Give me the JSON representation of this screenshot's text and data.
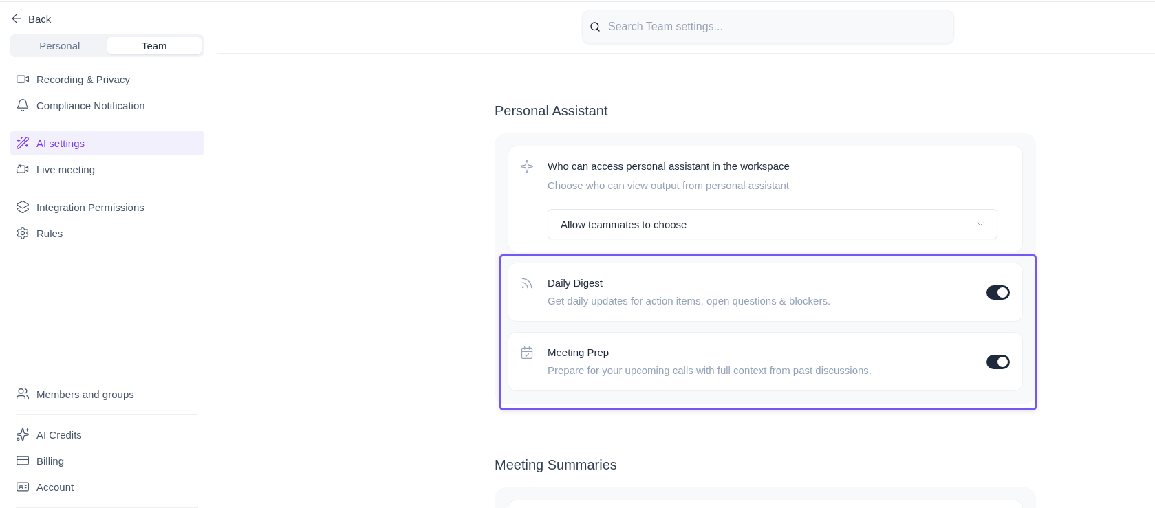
{
  "sidebar": {
    "back": "Back",
    "scope_tabs": [
      {
        "label": "Personal",
        "selected": false
      },
      {
        "label": "Team",
        "selected": true
      }
    ],
    "top_sections": [
      {
        "items": [
          {
            "label": "Recording & Privacy",
            "selected": false
          },
          {
            "label": "Compliance Notification",
            "selected": false
          }
        ]
      },
      {
        "items": [
          {
            "label": "AI settings",
            "selected": true
          },
          {
            "label": "Live meeting",
            "selected": false
          }
        ]
      },
      {
        "items": [
          {
            "label": "Integration Permissions",
            "selected": false
          },
          {
            "label": "Rules",
            "selected": false
          }
        ]
      }
    ],
    "bottom_sections": [
      {
        "items": [
          {
            "label": "Members and groups",
            "selected": false
          }
        ]
      },
      {
        "items": [
          {
            "label": "AI Credits",
            "selected": false
          },
          {
            "label": "Billing",
            "selected": false
          },
          {
            "label": "Account",
            "selected": false
          }
        ]
      }
    ]
  },
  "search": {
    "placeholder": "Search Team settings..."
  },
  "sections": [
    {
      "title": "Personal Assistant",
      "settings": [
        {
          "kind": "select",
          "title": "Who can access personal assistant in the workspace",
          "description": "Choose who can view output from personal assistant",
          "value": "Allow teammates to choose",
          "highlighted": false
        },
        {
          "kind": "toggle",
          "title": "Daily Digest",
          "description": "Get daily updates for action items, open questions & blockers.",
          "on": true,
          "highlighted": true
        },
        {
          "kind": "toggle",
          "title": "Meeting Prep",
          "description": "Prepare for your upcoming calls with full context from past discussions.",
          "on": true,
          "highlighted": true
        }
      ]
    },
    {
      "title": "Meeting Summaries"
    }
  ]
}
